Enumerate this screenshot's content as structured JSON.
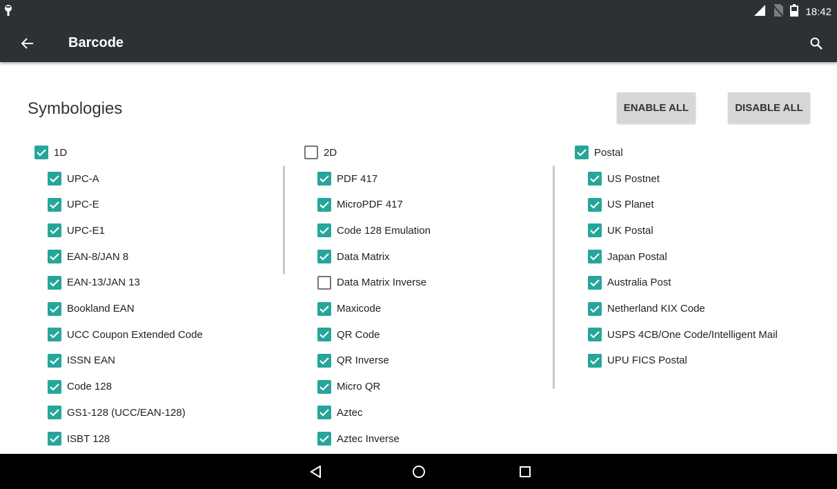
{
  "status_bar": {
    "time": "18:42"
  },
  "app_bar": {
    "title": "Barcode"
  },
  "heading": "Symbologies",
  "buttons": {
    "enable_all": "ENABLE ALL",
    "disable_all": "DISABLE ALL"
  },
  "accent_color": "#26a69a",
  "columns": [
    {
      "header": {
        "label": "1D",
        "checked": true
      },
      "items": [
        {
          "label": "UPC-A",
          "checked": true
        },
        {
          "label": "UPC-E",
          "checked": true
        },
        {
          "label": "UPC-E1",
          "checked": true
        },
        {
          "label": "EAN-8/JAN 8",
          "checked": true
        },
        {
          "label": "EAN-13/JAN 13",
          "checked": true
        },
        {
          "label": "Bookland EAN",
          "checked": true
        },
        {
          "label": "UCC Coupon Extended Code",
          "checked": true
        },
        {
          "label": "ISSN EAN",
          "checked": true
        },
        {
          "label": "Code 128",
          "checked": true
        },
        {
          "label": "GS1-128 (UCC/EAN-128)",
          "checked": true
        },
        {
          "label": "ISBT 128",
          "checked": true
        }
      ]
    },
    {
      "header": {
        "label": "2D",
        "checked": false
      },
      "items": [
        {
          "label": "PDF 417",
          "checked": true
        },
        {
          "label": "MicroPDF 417",
          "checked": true
        },
        {
          "label": "Code 128 Emulation",
          "checked": true
        },
        {
          "label": "Data Matrix",
          "checked": true
        },
        {
          "label": "Data Matrix Inverse",
          "checked": false
        },
        {
          "label": "Maxicode",
          "checked": true
        },
        {
          "label": "QR Code",
          "checked": true
        },
        {
          "label": "QR Inverse",
          "checked": true
        },
        {
          "label": "Micro QR",
          "checked": true
        },
        {
          "label": "Aztec",
          "checked": true
        },
        {
          "label": "Aztec Inverse",
          "checked": true
        }
      ]
    },
    {
      "header": {
        "label": "Postal",
        "checked": true
      },
      "items": [
        {
          "label": "US Postnet",
          "checked": true
        },
        {
          "label": "US Planet",
          "checked": true
        },
        {
          "label": "UK Postal",
          "checked": true
        },
        {
          "label": "Japan Postal",
          "checked": true
        },
        {
          "label": "Australia Post",
          "checked": true
        },
        {
          "label": "Netherland KIX Code",
          "checked": true
        },
        {
          "label": "USPS 4CB/One Code/Intelligent Mail",
          "checked": true
        },
        {
          "label": "UPU FICS Postal",
          "checked": true
        }
      ]
    }
  ]
}
